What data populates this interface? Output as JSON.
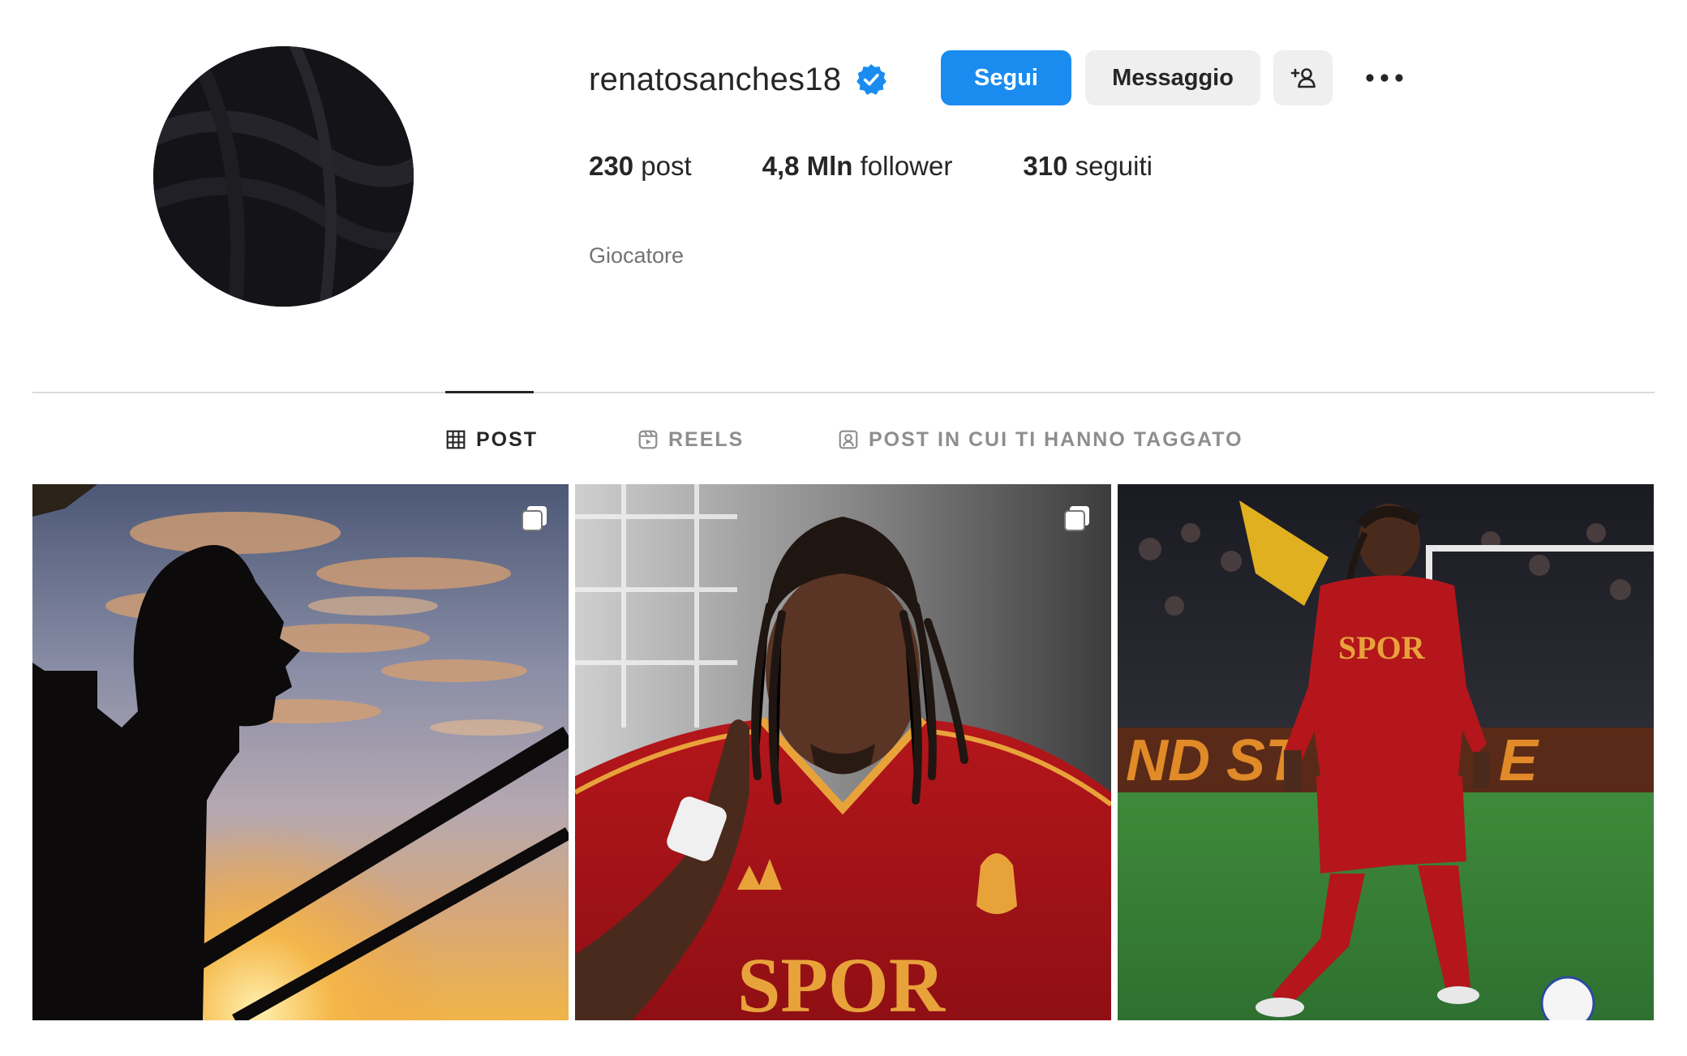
{
  "profile": {
    "username": "renatosanches18",
    "verified": true,
    "category": "Giocatore"
  },
  "actions": {
    "follow_label": "Segui",
    "message_label": "Messaggio"
  },
  "stats": {
    "posts_count": "230",
    "posts_label": "post",
    "followers_count": "4,8 Mln",
    "followers_label": "follower",
    "following_count": "310",
    "following_label": "seguiti"
  },
  "tabs": [
    {
      "label": "POST",
      "icon": "grid-icon",
      "active": true
    },
    {
      "label": "REELS",
      "icon": "reels-icon",
      "active": false
    },
    {
      "label": "POST IN CUI TI HANNO TAGGATO",
      "icon": "tagged-icon",
      "active": false
    }
  ],
  "grid": [
    {
      "description": "silhouette",
      "carousel": true
    },
    {
      "description": "player-closeup",
      "carousel": true
    },
    {
      "description": "player-on-pitch",
      "carousel": false
    }
  ],
  "colors": {
    "accent": "#1a8cf0",
    "verified": "#1a8cf0",
    "secondary_button": "#efefef",
    "muted_text": "#737373"
  }
}
